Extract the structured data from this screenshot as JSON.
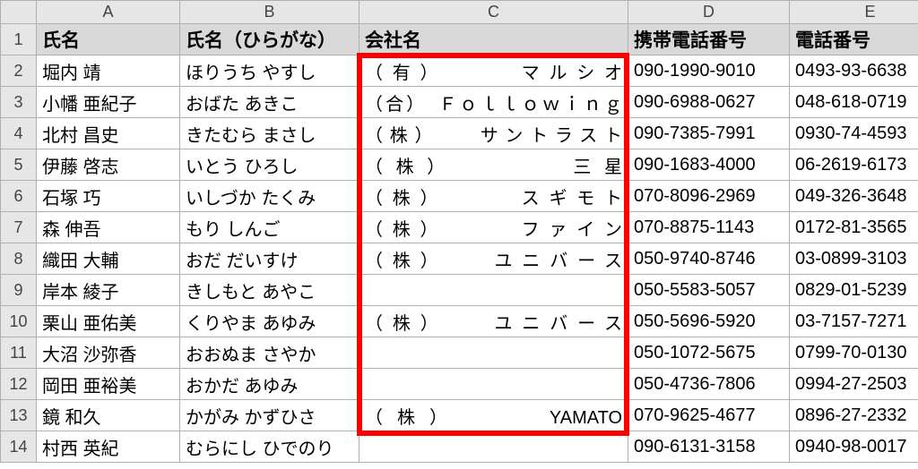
{
  "columns": {
    "letters": [
      "A",
      "B",
      "C",
      "D",
      "E"
    ],
    "headers": [
      "氏名",
      "氏名（ひらがな）",
      "会社名",
      "携帯電話番号",
      "電話番号"
    ]
  },
  "rows": [
    {
      "n": 2,
      "name": "堀内 靖",
      "kana": "ほりうち やすし",
      "company": "（有）　　　マルシオ",
      "mobile": "090-1990-9010",
      "phone": "0493-93-6638"
    },
    {
      "n": 3,
      "name": "小幡 亜紀子",
      "kana": "おばた あきこ",
      "company": "（合）　Ｆｏｌｌｏｗｉｎｇ",
      "mobile": "090-6988-0627",
      "phone": "048-618-0719"
    },
    {
      "n": 4,
      "name": "北村 昌史",
      "kana": "きたむら まさし",
      "company": "（株）　　サントラスト",
      "mobile": "090-7385-7991",
      "phone": "0930-74-4593"
    },
    {
      "n": 5,
      "name": "伊藤 啓志",
      "kana": "いとう ひろし",
      "company": "（株）　　　　三星",
      "mobile": "090-1683-4000",
      "phone": "06-2619-6173"
    },
    {
      "n": 6,
      "name": "石塚 巧",
      "kana": "いしづか たくみ",
      "company": "（株）　　　スギモト",
      "mobile": "070-8096-2969",
      "phone": "049-326-3648"
    },
    {
      "n": 7,
      "name": "森 伸吾",
      "kana": "もり しんご",
      "company": "（株）　　　ファイン",
      "mobile": "070-8875-1143",
      "phone": "0172-81-3565"
    },
    {
      "n": 8,
      "name": "織田 大輔",
      "kana": "おだ だいすけ",
      "company": "（株）　　ユニバース",
      "mobile": "050-9740-8746",
      "phone": "03-0899-3103"
    },
    {
      "n": 9,
      "name": "岸本 綾子",
      "kana": "きしもと あやこ",
      "company": "",
      "mobile": "050-5583-5057",
      "phone": "0829-01-5239"
    },
    {
      "n": 10,
      "name": "栗山 亜佑美",
      "kana": "くりやま あゆみ",
      "company": "（株）　　ユニバース",
      "mobile": "050-5696-5920",
      "phone": "03-7157-7271"
    },
    {
      "n": 11,
      "name": "大沼 沙弥香",
      "kana": "おおぬま さやか",
      "company": "",
      "mobile": "050-1072-5675",
      "phone": "0799-70-0130"
    },
    {
      "n": 12,
      "name": "岡田 亜裕美",
      "kana": "おかだ あゆみ",
      "company": "",
      "mobile": "050-4736-7806",
      "phone": "0994-27-2503"
    },
    {
      "n": 13,
      "name": "鏡 和久",
      "kana": "かがみ かずひさ",
      "company": "（株）　　　YAMATO",
      "mobile": "070-9625-4677",
      "phone": "0896-27-2332"
    },
    {
      "n": 14,
      "name": "村西 英紀",
      "kana": "むらにし ひでのり",
      "company": "",
      "mobile": "090-6131-3158",
      "phone": "0940-98-0017"
    }
  ],
  "highlight": {
    "col": "C",
    "from_row": 2,
    "to_row": 13
  }
}
